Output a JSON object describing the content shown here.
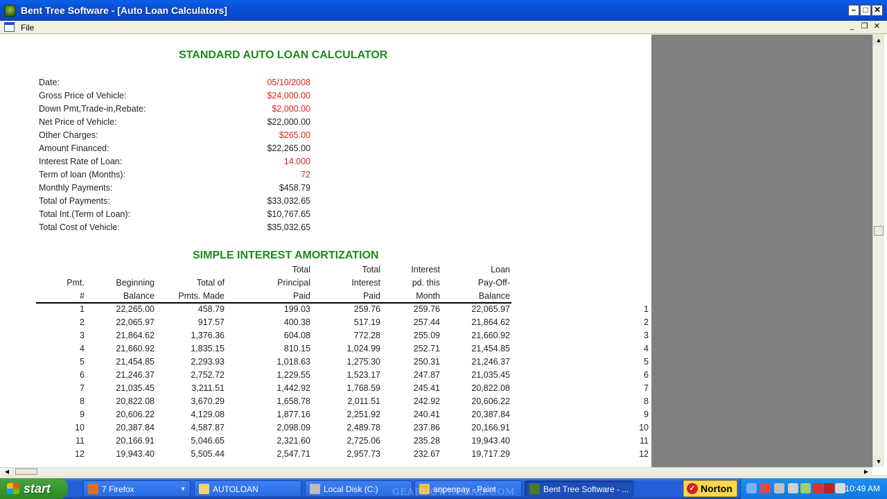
{
  "window": {
    "title": "Bent Tree Software - [Auto Loan Calculators]"
  },
  "menu": {
    "file": "File"
  },
  "calculator": {
    "heading": "STANDARD AUTO LOAN CALCULATOR",
    "fields": [
      {
        "label": "Date:",
        "value": "05/10/2008",
        "kind": "input"
      },
      {
        "label": "Gross Price of Vehicle:",
        "value": "$24,000.00",
        "kind": "input"
      },
      {
        "label": "Down Pmt,Trade-in,Rebate:",
        "value": "$2,000.00",
        "kind": "input"
      },
      {
        "label": "Net Price of Vehicle:",
        "value": "$22,000.00",
        "kind": "calc"
      },
      {
        "label": "Other Charges:",
        "value": "$265.00",
        "kind": "input"
      },
      {
        "label": "Amount Financed:",
        "value": "$22,265.00",
        "kind": "calc"
      },
      {
        "label": "Interest Rate of Loan:",
        "value": "14.000",
        "kind": "input"
      },
      {
        "label": "Term of loan (Months):",
        "value": "72",
        "kind": "input"
      },
      {
        "label": "Monthly Payments:",
        "value": "$458.79",
        "kind": "calc"
      },
      {
        "label": "Total of Payments:",
        "value": "$33,032.65",
        "kind": "calc"
      },
      {
        "label": "Total Int.(Term of Loan):",
        "value": "$10,767.65",
        "kind": "calc"
      },
      {
        "label": "Total Cost of Vehicle:",
        "value": "$35,032.65",
        "kind": "calc"
      }
    ]
  },
  "amortization": {
    "heading": "SIMPLE INTEREST AMORTIZATION",
    "headers": [
      [
        "",
        "Pmt.",
        "#"
      ],
      [
        "",
        "Beginning",
        "Balance"
      ],
      [
        "",
        "Total of",
        "Pmts. Made"
      ],
      [
        "Total",
        "Principal",
        "Paid"
      ],
      [
        "Total",
        "Interest",
        "Paid"
      ],
      [
        "Interest",
        "pd. this",
        "Month"
      ],
      [
        "Loan",
        "Pay-Off-",
        "Balance"
      ]
    ],
    "rows": [
      [
        "1",
        "22,265.00",
        "458.79",
        "199.03",
        "259.76",
        "259.76",
        "22,065.97",
        "1"
      ],
      [
        "2",
        "22,065.97",
        "917.57",
        "400.38",
        "517.19",
        "257.44",
        "21,864.62",
        "2"
      ],
      [
        "3",
        "21,864.62",
        "1,376.36",
        "604.08",
        "772.28",
        "255.09",
        "21,660.92",
        "3"
      ],
      [
        "4",
        "21,660.92",
        "1,835.15",
        "810.15",
        "1,024.99",
        "252.71",
        "21,454.85",
        "4"
      ],
      [
        "5",
        "21,454.85",
        "2,293.93",
        "1,018.63",
        "1,275.30",
        "250.31",
        "21,246.37",
        "5"
      ],
      [
        "6",
        "21,246.37",
        "2,752.72",
        "1,229.55",
        "1,523.17",
        "247.87",
        "21,035.45",
        "6"
      ],
      [
        "7",
        "21,035.45",
        "3,211.51",
        "1,442.92",
        "1,768.59",
        "245.41",
        "20,822.08",
        "7"
      ],
      [
        "8",
        "20,822.08",
        "3,670.29",
        "1,658.78",
        "2,011.51",
        "242.92",
        "20,606.22",
        "8"
      ],
      [
        "9",
        "20,606.22",
        "4,129.08",
        "1,877.16",
        "2,251.92",
        "240.41",
        "20,387.84",
        "9"
      ],
      [
        "10",
        "20,387.84",
        "4,587.87",
        "2,098.09",
        "2,489.78",
        "237.86",
        "20,166.91",
        "10"
      ],
      [
        "11",
        "20,166.91",
        "5,046.65",
        "2,321.60",
        "2,725.06",
        "235.28",
        "19,943.40",
        "11"
      ],
      [
        "12",
        "19,943.40",
        "5,505.44",
        "2,547.71",
        "2,957.73",
        "232.67",
        "19,717.29",
        "12"
      ]
    ]
  },
  "taskbar": {
    "start": "start",
    "tasks": [
      {
        "label": "7 Firefox",
        "active": false,
        "color": "#e07020"
      },
      {
        "label": "AUTOLOAN",
        "active": false,
        "color": "#f3d36b"
      },
      {
        "label": "Local Disk (C:)",
        "active": false,
        "color": "#bbbbbb"
      },
      {
        "label": "anpenpay - Paint",
        "active": false,
        "color": "#e8c050"
      },
      {
        "label": "Bent Tree Software - ...",
        "active": true,
        "color": "#4a7a20"
      }
    ],
    "norton": "Norton",
    "clock": "10:49 AM"
  },
  "watermark": "GEARDOWNLOAD.COM"
}
